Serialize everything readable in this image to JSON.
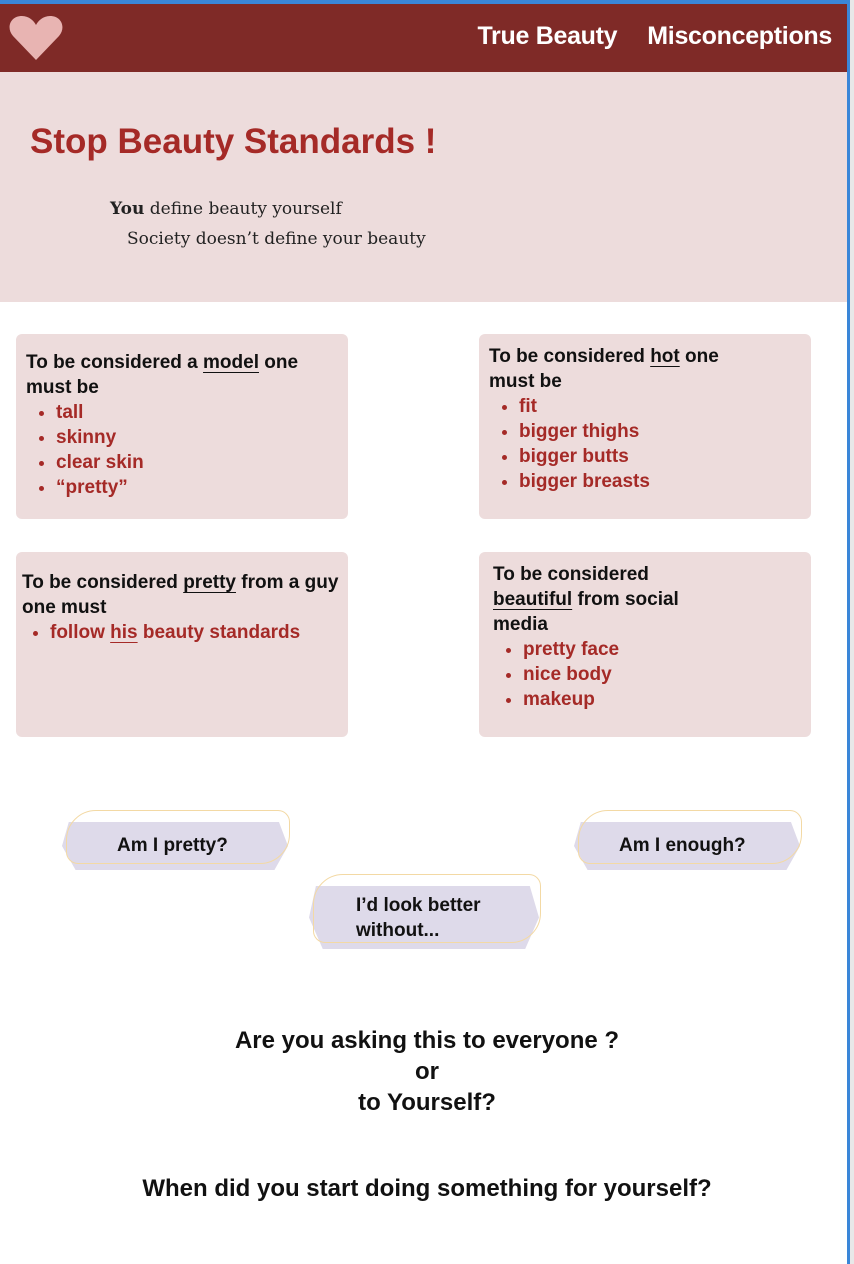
{
  "nav": {
    "items": [
      "True Beauty",
      "Misconceptions"
    ]
  },
  "hero": {
    "title": "Stop Beauty Standards !",
    "tagline_bold": "You",
    "tagline_rest": " define beauty yourself",
    "tagline2": "Society doesn’t define your beauty"
  },
  "cards": [
    {
      "pre": "To be considered a ",
      "key": "model",
      "post": " one must be",
      "items": [
        "tall",
        "skinny",
        "clear skin",
        "“pretty”"
      ]
    },
    {
      "pre": "To be considered ",
      "key": "hot",
      "post": " one must be",
      "items": [
        "fit",
        "bigger thighs",
        "bigger butts",
        "bigger breasts"
      ]
    },
    {
      "pre": "To be considered ",
      "key": "pretty",
      "post": " from a guy one must",
      "item_pre": "follow ",
      "item_key": "his",
      "item_post": " beauty standards"
    },
    {
      "pre": "To be considered ",
      "key": "beautiful",
      "post": " from social media",
      "items": [
        "pretty face",
        "nice body",
        "makeup"
      ]
    }
  ],
  "questions": [
    "Am I pretty?",
    "Am I enough?",
    "I’d look better without..."
  ],
  "closing": {
    "line1": "Are you asking this to everyone ?",
    "line2": "or",
    "line3": "to Yourself?",
    "line4": "When did you start doing something for yourself?"
  },
  "colors": {
    "header": "#7f2a27",
    "accent": "#a52a27",
    "panel": "#eddcdc",
    "bubble": "#dedaea"
  }
}
